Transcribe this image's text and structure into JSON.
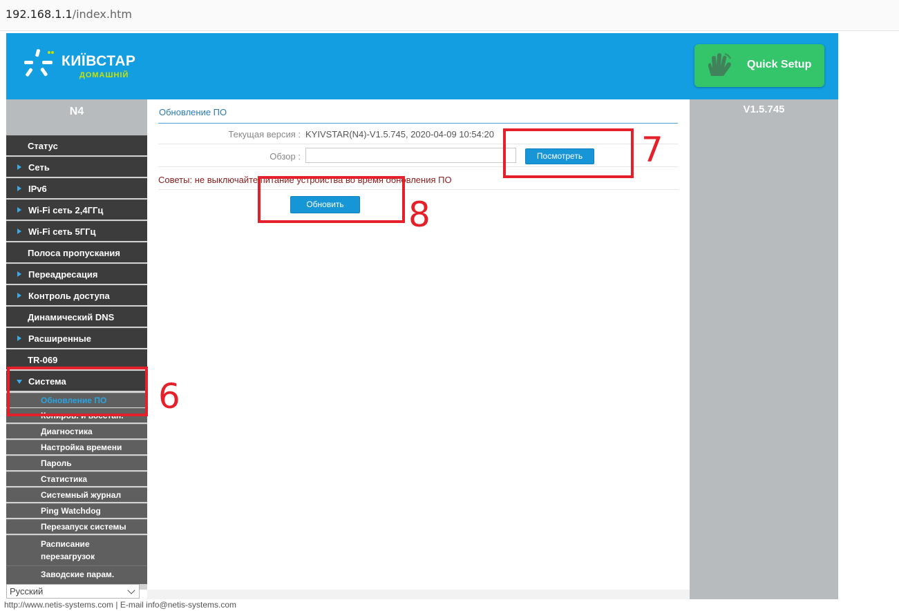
{
  "browser": {
    "url_host": "192.168.1.1",
    "url_path": "/index.htm"
  },
  "header": {
    "logo_text": "КИЇВСТАР",
    "logo_subtext": "ДОМАШНІЙ",
    "quick_setup_label": "Quick Setup"
  },
  "sidebar": {
    "model": "N4",
    "items": [
      {
        "label": "Статус",
        "arrow": "none"
      },
      {
        "label": "Сеть",
        "arrow": "right"
      },
      {
        "label": "IPv6",
        "arrow": "right"
      },
      {
        "label": "Wi-Fi сеть 2,4ГГц",
        "arrow": "right"
      },
      {
        "label": "Wi-Fi сеть 5ГГц",
        "arrow": "right"
      },
      {
        "label": "Полоса пропускания",
        "arrow": "none"
      },
      {
        "label": "Переадресация",
        "arrow": "right"
      },
      {
        "label": "Контроль доступа",
        "arrow": "right"
      },
      {
        "label": "Динамический DNS",
        "arrow": "none"
      },
      {
        "label": "Расширенные",
        "arrow": "right"
      },
      {
        "label": "TR-069",
        "arrow": "none"
      },
      {
        "label": "Система",
        "arrow": "down"
      }
    ],
    "subitems": [
      {
        "label": "Обновление ПО",
        "active": true
      },
      {
        "label": "Копиров. и восстан."
      },
      {
        "label": "Диагностика"
      },
      {
        "label": "Настройка времени"
      },
      {
        "label": "Пароль"
      },
      {
        "label": "Статистика"
      },
      {
        "label": "Системный журнал"
      },
      {
        "label": "Ping Watchdog"
      },
      {
        "label": "Перезапуск системы"
      },
      {
        "label": "Расписание перезагрузок"
      },
      {
        "label": "Заводские парам."
      }
    ],
    "language": "Русский"
  },
  "right_panel": {
    "version": "V1.5.745"
  },
  "content": {
    "title": "Обновление ПО",
    "current_version_label": "Текущая версия :",
    "current_version_value": "KYIVSTAR(N4)-V1.5.745, 2020-04-09 10:54:20",
    "browse_label": "Обзор :",
    "browse_button": "Посмотреть",
    "tip": "Советы: не выключайте питание устройства во время обновления ПО",
    "update_button": "Обновить"
  },
  "annotations": {
    "mark6": "6",
    "mark7": "7",
    "mark8": "8"
  },
  "footer": {
    "text": "http://www.netis-systems.com | E-mail info@netis-systems.com"
  },
  "colors": {
    "header_blue": "#129ee0",
    "quick_setup_green": "#34c56a",
    "annotation_red": "#e4202a",
    "button_blue": "#1796d7"
  }
}
